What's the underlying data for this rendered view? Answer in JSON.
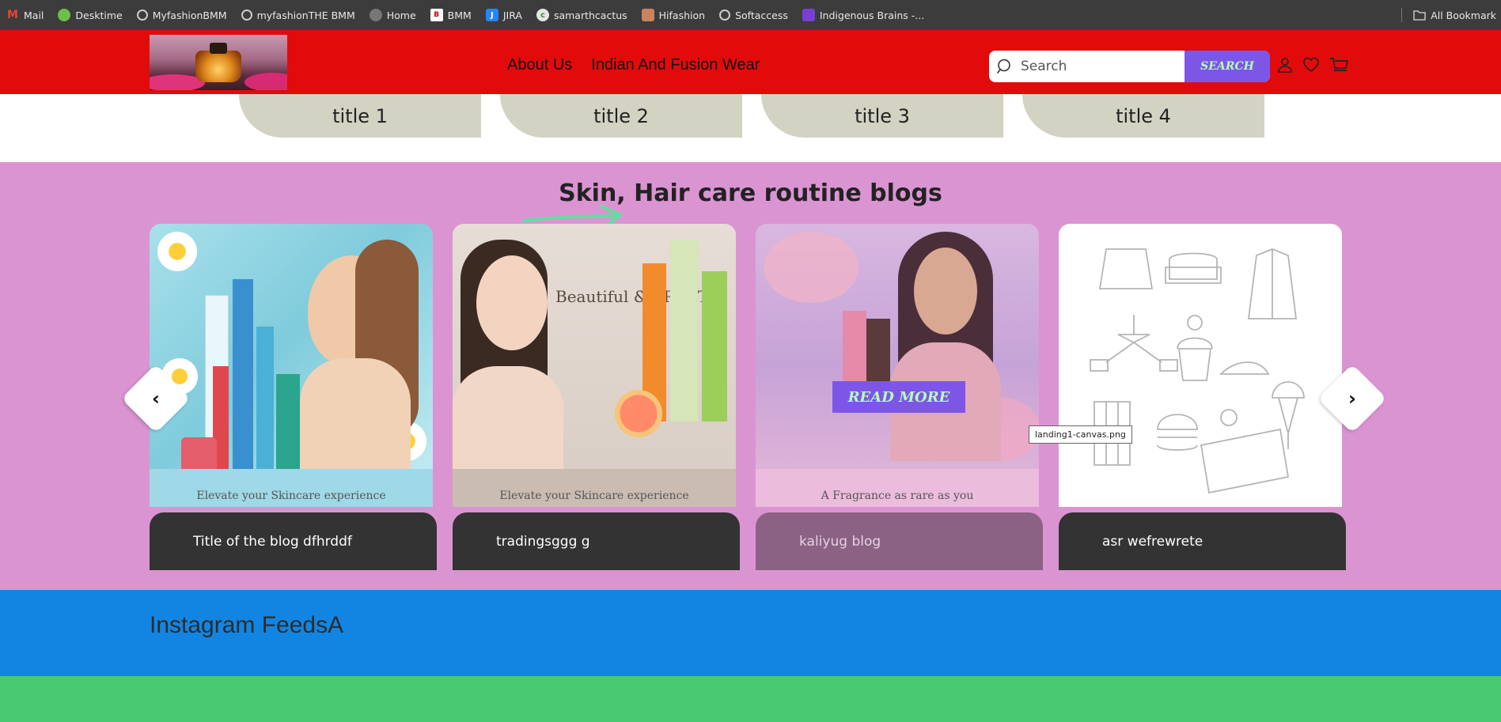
{
  "bookmarks": {
    "items": [
      {
        "label": "Mail",
        "icon": "gmail-icon"
      },
      {
        "label": "Desktime",
        "icon": "desktime-icon"
      },
      {
        "label": "MyfashionBMM",
        "icon": "globe-icon"
      },
      {
        "label": "myfashionTHE BMM",
        "icon": "globe-icon"
      },
      {
        "label": "Home",
        "icon": "globe-icon"
      },
      {
        "label": "BMM",
        "icon": "bmm-icon"
      },
      {
        "label": "JIRA",
        "icon": "jira-icon"
      },
      {
        "label": "samarthcactus",
        "icon": "cactus-icon"
      },
      {
        "label": "Hifashion",
        "icon": "hifashion-icon"
      },
      {
        "label": "Softaccess",
        "icon": "globe-icon"
      },
      {
        "label": "Indigenous Brains -...",
        "icon": "brains-icon"
      }
    ],
    "all_bookmarks": "All Bookmark"
  },
  "header": {
    "nav": [
      "About Us",
      "Indian And Fusion Wear"
    ],
    "search_placeholder": "Search",
    "search_button": "SEARCH"
  },
  "titles": [
    "title 1",
    "title 2",
    "title 3",
    "title 4"
  ],
  "blogs": {
    "heading": "Skin, Hair care routine blogs",
    "cards": [
      {
        "title": "Title of the blog dfhrddf",
        "image_caption": "Elevate your Skincare experience"
      },
      {
        "title": "tradingsggg g",
        "image_caption": "Elevate your Skincare experience",
        "image_text": "Beautiful & PRETTY"
      },
      {
        "title": "kaliyug blog",
        "image_caption": "A Fragrance as rare as you"
      },
      {
        "title": "asr wefrewrete"
      }
    ],
    "read_more": "READ MORE",
    "tooltip": "landing1-canvas.png",
    "prev_symbol": "‹",
    "next_symbol": "›"
  },
  "instagram": {
    "heading": "Instagram FeedsA"
  },
  "colors": {
    "header_bg": "#e20b0b",
    "blogs_bg": "#db94d2",
    "instagram_bg": "#1285e3",
    "footer_green": "#49ca72",
    "accent_purple": "#7d56e8",
    "accent_green_text": "#b6ffb3"
  }
}
